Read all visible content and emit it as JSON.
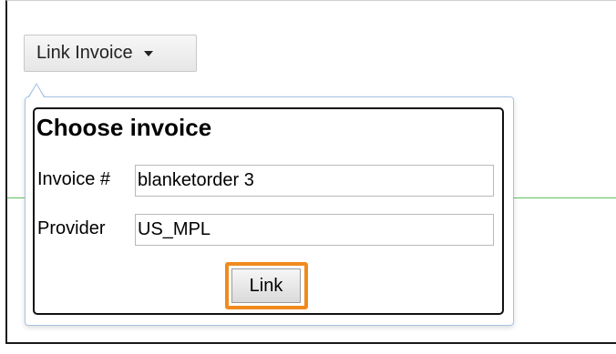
{
  "toolbar": {
    "dropdown_label": "Link Invoice"
  },
  "dialog": {
    "title": "Choose invoice",
    "invoice_label": "Invoice #",
    "invoice_value": "blanketorder 3",
    "provider_label": "Provider",
    "provider_value": "US_MPL",
    "link_button_label": "Link"
  },
  "colors": {
    "focus_ring": "#f08a1d",
    "divider_line": "#5fbf5f",
    "popover_border": "#a7c4e2"
  }
}
